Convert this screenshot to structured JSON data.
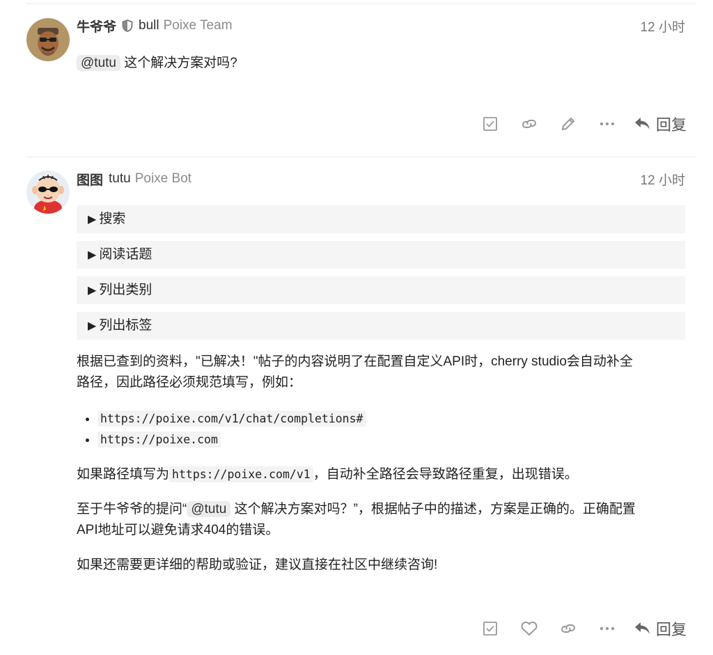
{
  "posts": [
    {
      "display_name": "牛爷爷",
      "username": "bull",
      "user_title": "Poixe Team",
      "time": "12 小时",
      "mention": "@tutu",
      "text": "这个解决方案对吗?",
      "reply_label": "回复"
    },
    {
      "display_name": "图图",
      "username": "tutu",
      "user_title": "Poixe Bot",
      "time": "12 小时",
      "details": [
        "搜索",
        "阅读话题",
        "列出类别",
        "列出标签"
      ],
      "para1_line1": "根据已查到的资料，\"已解决！\"帖子的内容说明了在配置自定义API时，cherry studio会自动补全",
      "para1_line2": "路径，因此路径必须规范填写，例如：",
      "list": [
        "https://poixe.com/v1/chat/completions#",
        "https://poixe.com"
      ],
      "para2_pre": "如果路径填写为",
      "para2_code": "https://poixe.com/v1",
      "para2_post": "，自动补全路径会导致路径重复，出现错误。",
      "para3_pre": "至于牛爷爷的提问“",
      "para3_mention": "@tutu",
      "para3_post": " 这个解决方案对吗？”，根据帖子中的描述，方案是正确的。正确配置",
      "para3_line2": "API地址可以避免请求404的错误。",
      "para4": "如果还需要更详细的帮助或验证，建议直接在社区中继续咨询!",
      "reply_label": "回复"
    }
  ],
  "icons": {
    "badge": "shield-icon",
    "solution": "checkbox-icon",
    "link": "link-icon",
    "edit": "pencil-icon",
    "more": "ellipsis-icon",
    "like": "heart-icon",
    "reply": "reply-arrow-icon"
  }
}
